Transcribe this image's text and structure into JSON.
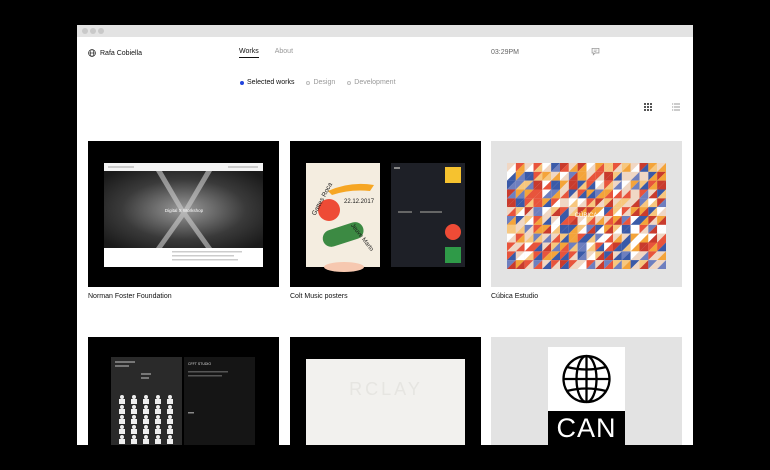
{
  "brand": {
    "name": "Rafa Cobiella"
  },
  "nav": [
    {
      "label": "Works",
      "active": true
    },
    {
      "label": "About",
      "active": false
    }
  ],
  "clock": "03:29PM",
  "filters": [
    {
      "label": "Selected works",
      "active": true
    },
    {
      "label": "Design",
      "active": false
    },
    {
      "label": "Development",
      "active": false
    }
  ],
  "projects": [
    {
      "title": "Norman Foster Foundation",
      "thumb_text": "Digital X Workshop"
    },
    {
      "title": "Colt Music posters",
      "thumb_text": [
        "22.12.2017",
        "Gattes Roca",
        "Jeuve Marto"
      ]
    },
    {
      "title": "Cúbica Estudio",
      "thumb_text": "CÚBICA"
    },
    {
      "title": "",
      "thumb_text": "CFFT STUDIO"
    },
    {
      "title": "",
      "thumb_text": "RCLAY"
    },
    {
      "title": "",
      "thumb_text": "CAN"
    }
  ],
  "colors": {
    "accent": "#2244dd",
    "background": "#000000",
    "window": "#ffffff",
    "muted": "#999999"
  }
}
